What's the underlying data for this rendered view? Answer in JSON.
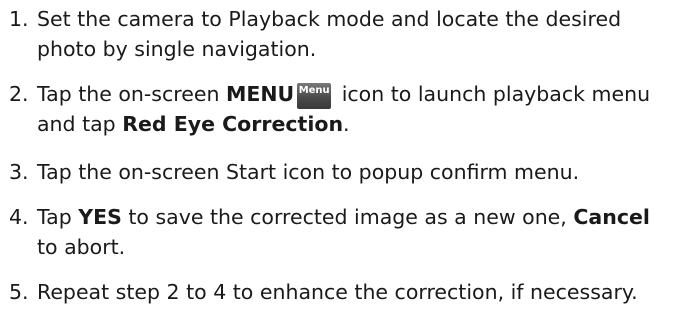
{
  "steps": [
    {
      "num": "1.",
      "line1": "Set the camera to Playback mode and locate the desired",
      "line2": "photo by single navigation."
    },
    {
      "num": "2.",
      "pre": "Tap the on-screen ",
      "bold1": "MENU",
      "icon_label": "Menu",
      "post": " icon to launch playback menu",
      "line2_pre": "and tap ",
      "line2_bold": "Red Eye Correction",
      "line2_post": "."
    },
    {
      "num": "3.",
      "line1": "Tap the on-screen Start icon to popup confirm menu."
    },
    {
      "num": "4.",
      "pre": "Tap ",
      "bold1": "YES",
      "mid": " to save the corrected image as a new one, ",
      "bold2": "Cancel",
      "line2": "to abort."
    },
    {
      "num": "5.",
      "line1": "Repeat step 2 to 4 to enhance the correction, if necessary."
    }
  ]
}
